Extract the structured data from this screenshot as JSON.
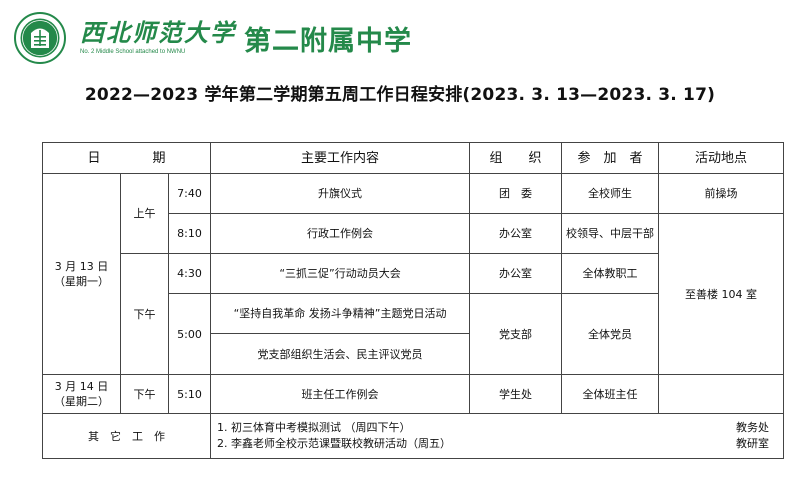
{
  "header": {
    "university": "西北师范大学",
    "university_en": "No. 2 Middle School attached to NWNU",
    "school": "第二附属中学"
  },
  "title": "2022—2023 学年第二学期第五周工作日程安排(2023. 3. 13—2023. 3. 17)",
  "table": {
    "headers": {
      "date": "日　　　　期",
      "content": "主要工作内容",
      "org": "组　　织",
      "participants": "参　加　者",
      "location": "活动地点"
    },
    "day1": {
      "date": "3 月 13 日",
      "weekday": "（星期一）",
      "am": "上午",
      "pm": "下午"
    },
    "day2": {
      "date": "3 月 14 日",
      "weekday": "（星期二）",
      "pm": "下午"
    },
    "rows": [
      {
        "time": "7:40",
        "content": "升旗仪式",
        "org": "团　委",
        "participants": "全校师生",
        "location": "前操场"
      },
      {
        "time": "8:10",
        "content": "行政工作例会",
        "org": "办公室",
        "participants": "校领导、中层干部",
        "location": "至善楼 104 室"
      },
      {
        "time": "4:30",
        "content": "“三抓三促”行动动员大会",
        "org": "办公室",
        "participants": "全体教职工"
      },
      {
        "time": "5:00",
        "content": "“坚持自我革命 发扬斗争精神”主题党日活动",
        "org": "党支部",
        "participants": "全体党员"
      },
      {
        "content": "党支部组织生活会、民主评议党员"
      },
      {
        "time": "5:10",
        "content": "班主任工作例会",
        "org": "学生处",
        "participants": "全体班主任"
      }
    ],
    "other": {
      "label": "其　它　工　作",
      "items": [
        {
          "text": "1.  初三体育中考模拟测试 （周四下午）",
          "dept": "教务处"
        },
        {
          "text": "2.  李鑫老师全校示范课暨联校教研活动（周五）",
          "dept": "教研室"
        }
      ]
    }
  }
}
